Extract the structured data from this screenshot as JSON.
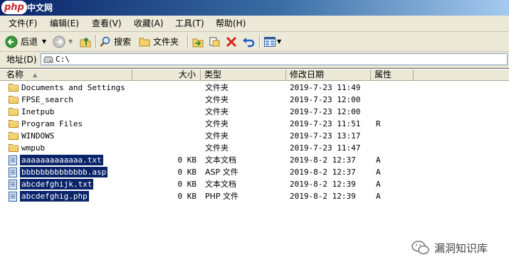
{
  "titlebar": {
    "logo_text": "php",
    "title": "中文网"
  },
  "menu": [
    {
      "label": "文件(F)"
    },
    {
      "label": "编辑(E)"
    },
    {
      "label": "查看(V)"
    },
    {
      "label": "收藏(A)"
    },
    {
      "label": "工具(T)"
    },
    {
      "label": "帮助(H)"
    }
  ],
  "toolbar": {
    "back_label": "后退",
    "search_label": "搜索",
    "folders_label": "文件夹"
  },
  "address": {
    "label": "地址(D)",
    "value": "C:\\"
  },
  "columns": {
    "name": "名称",
    "size": "大小",
    "type": "类型",
    "modified": "修改日期",
    "attributes": "属性"
  },
  "files": [
    {
      "name": "Documents and Settings",
      "size": "",
      "type": "文件夹",
      "modified": "2019-7-23 11:49",
      "attr": "",
      "kind": "folder",
      "selected": false
    },
    {
      "name": "FPSE_search",
      "size": "",
      "type": "文件夹",
      "modified": "2019-7-23 12:00",
      "attr": "",
      "kind": "folder",
      "selected": false
    },
    {
      "name": "Inetpub",
      "size": "",
      "type": "文件夹",
      "modified": "2019-7-23 12:00",
      "attr": "",
      "kind": "folder",
      "selected": false
    },
    {
      "name": "Program Files",
      "size": "",
      "type": "文件夹",
      "modified": "2019-7-23 11:51",
      "attr": "R",
      "kind": "folder",
      "selected": false
    },
    {
      "name": "WINDOWS",
      "size": "",
      "type": "文件夹",
      "modified": "2019-7-23 13:17",
      "attr": "",
      "kind": "folder",
      "selected": false
    },
    {
      "name": "wmpub",
      "size": "",
      "type": "文件夹",
      "modified": "2019-7-23 11:47",
      "attr": "",
      "kind": "folder",
      "selected": false
    },
    {
      "name": "aaaaaaaaaaaaa.txt",
      "size": "0 KB",
      "type": "文本文档",
      "modified": "2019-8-2 12:37",
      "attr": "A",
      "kind": "file",
      "selected": true
    },
    {
      "name": "bbbbbbbbbbbbbb.asp",
      "size": "0 KB",
      "type": "ASP 文件",
      "modified": "2019-8-2 12:37",
      "attr": "A",
      "kind": "file",
      "selected": true
    },
    {
      "name": "abcdefghijk.txt",
      "size": "0 KB",
      "type": "文本文档",
      "modified": "2019-8-2 12:39",
      "attr": "A",
      "kind": "file",
      "selected": true
    },
    {
      "name": "abcdefghig.php",
      "size": "0 KB",
      "type": "PHP 文件",
      "modified": "2019-8-2 12:39",
      "attr": "A",
      "kind": "file",
      "selected": true
    }
  ],
  "watermark": {
    "text": "漏洞知识库",
    "icon": "wechat-icon"
  },
  "colors": {
    "selection": "#0a246a",
    "folder": "#f5d16a",
    "chrome": "#ece9d8"
  }
}
